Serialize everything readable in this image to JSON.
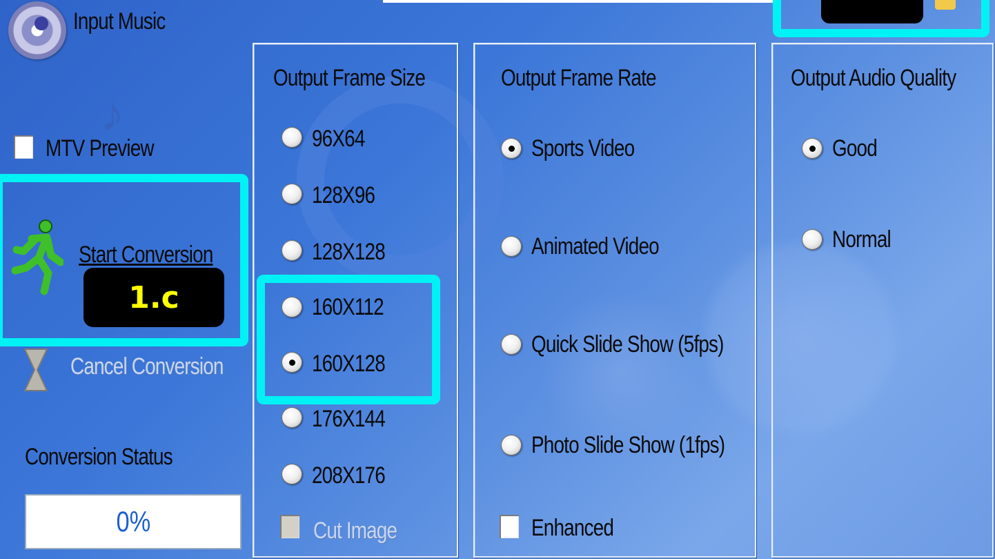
{
  "left": {
    "input_music_label": "Input Music",
    "mtv_preview_label": "MTV Preview",
    "mtv_preview_checked": false,
    "start_conversion_label": "Start Conversion",
    "cancel_conversion_label": "Cancel Conversion",
    "conversion_status_label": "Conversion Status",
    "progress_value": "0%",
    "step_badge": "1.c"
  },
  "frame_size": {
    "title": "Output Frame Size",
    "options": [
      "96X64",
      "128X96",
      "128X128",
      "160X112",
      "160X128",
      "176X144",
      "208X176"
    ],
    "selected": "160X128",
    "cut_image_label": "Cut Image"
  },
  "frame_rate": {
    "title": "Output Frame Rate",
    "options": [
      "Sports Video",
      "Animated Video",
      "Quick Slide Show (5fps)",
      "Photo Slide Show (1fps)"
    ],
    "selected": "Sports Video",
    "enhanced_label": "Enhanced"
  },
  "audio_quality": {
    "title": "Output Audio Quality",
    "options": [
      "Good",
      "Normal"
    ],
    "selected": "Good"
  },
  "colors": {
    "highlight": "#00f2f5",
    "badge_text": "#ffff00",
    "background": "#3b76d8"
  }
}
